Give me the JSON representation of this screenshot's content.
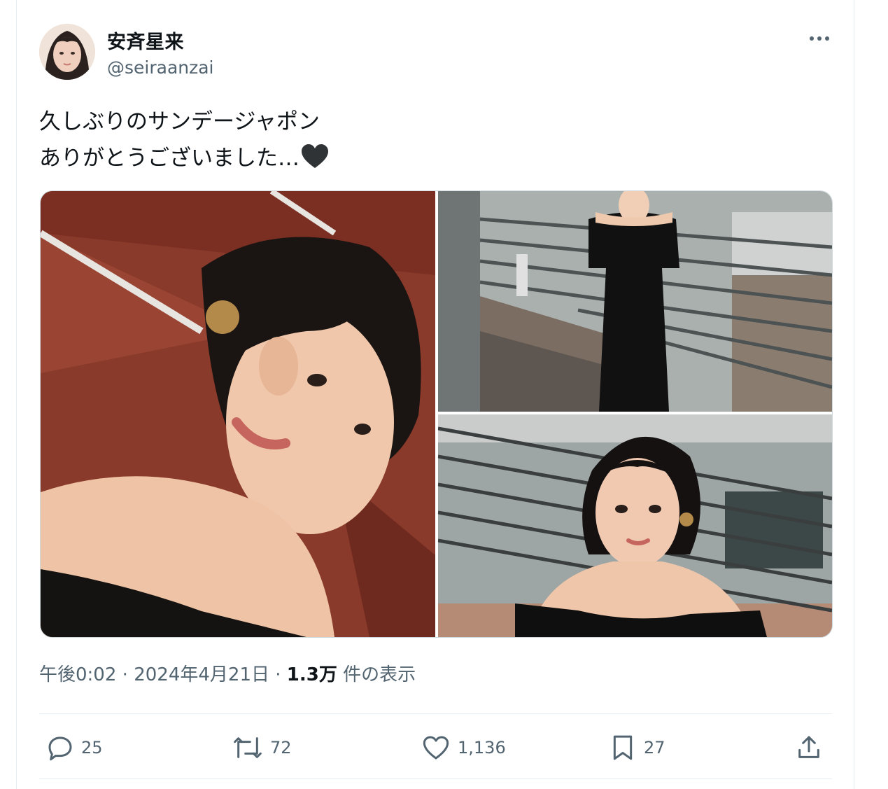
{
  "author": {
    "display_name": "安斉星来",
    "handle": "@seiraanzai"
  },
  "tweet": {
    "line1": "久しぶりのサンデージャポン",
    "line2": "ありがとうございました…",
    "emoji": "black-heart"
  },
  "media": {
    "count": 3
  },
  "meta": {
    "time": "午後0:02",
    "sep1": " · ",
    "date": "2024年4月21日",
    "sep2": " · ",
    "views": "1.3万",
    "views_suffix": " 件の表示"
  },
  "actions": {
    "replies": "25",
    "reposts": "72",
    "likes": "1,136",
    "bookmarks": "27"
  },
  "icons": [
    "more-icon",
    "reply-icon",
    "repost-icon",
    "like-icon",
    "bookmark-icon",
    "share-icon"
  ],
  "colors": {
    "text": "#0f1419",
    "secondary": "#536471",
    "border": "#cfd9de"
  }
}
